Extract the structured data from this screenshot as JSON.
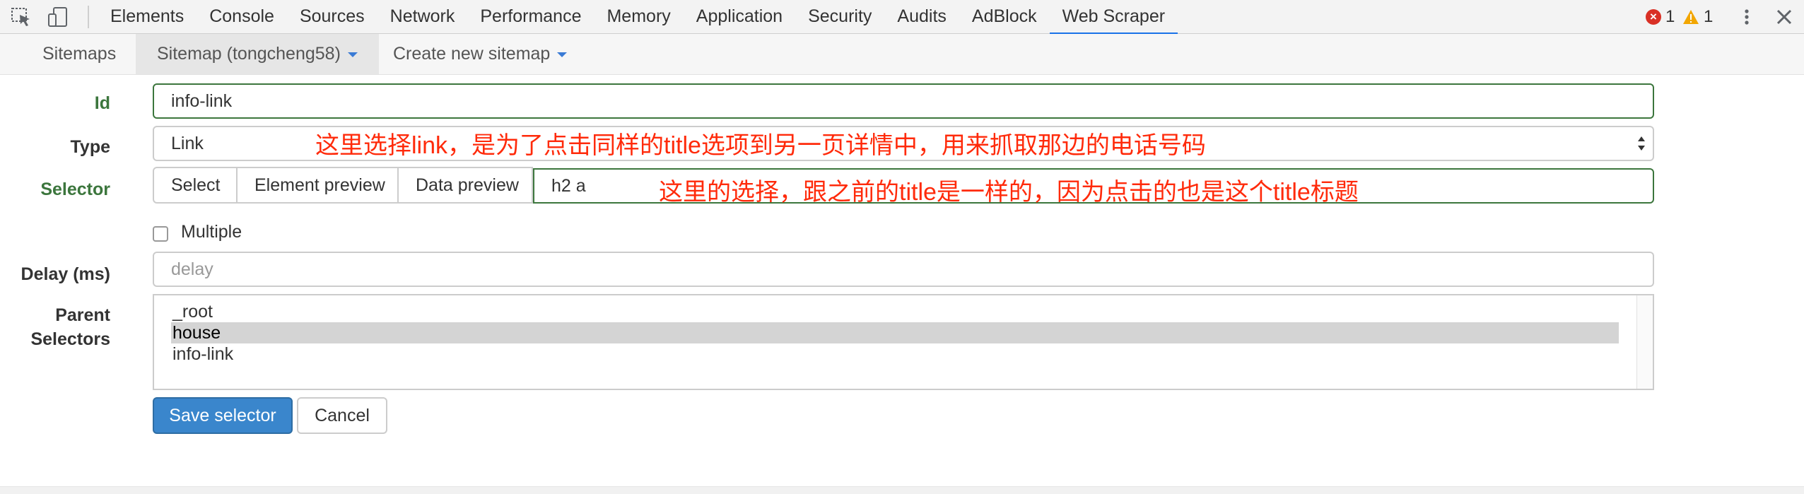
{
  "devtools": {
    "tabs": [
      "Elements",
      "Console",
      "Sources",
      "Network",
      "Performance",
      "Memory",
      "Application",
      "Security",
      "Audits",
      "AdBlock",
      "Web Scraper"
    ],
    "active_tab": "Web Scraper",
    "error_count": "1",
    "warning_count": "1",
    "icons": [
      "inspect-element-icon",
      "device-toolbar-icon",
      "error-icon",
      "warning-icon",
      "more-options-icon",
      "close-icon"
    ]
  },
  "nav": {
    "sitemaps": "Sitemaps",
    "current_sitemap": "Sitemap (tongcheng58)",
    "create_new": "Create new sitemap"
  },
  "form": {
    "id_label": "Id",
    "id_value": "info-link",
    "type_label": "Type",
    "type_value": "Link",
    "selector_label": "Selector",
    "select_button": "Select",
    "element_preview_button": "Element preview",
    "data_preview_button": "Data preview",
    "selector_value": "h2 a",
    "multiple_label": "Multiple",
    "multiple_checked": false,
    "delay_label": "Delay (ms)",
    "delay_placeholder": "delay",
    "parent_label_line1": "Parent",
    "parent_label_line2": "Selectors",
    "parent_options": [
      "_root",
      "house",
      "info-link"
    ],
    "parent_selected": "house",
    "save_button": "Save selector",
    "cancel_button": "Cancel"
  },
  "annotations": {
    "type_note": "这里选择link，是为了点击同样的title选项到另一页详情中，用来抓取那边的电话号码",
    "selector_note": "这里的选择，跟之前的title是一样的，因为点击的也是这个title标题"
  },
  "colors": {
    "success_green": "#3c763d",
    "primary_blue": "#3a86cc",
    "annotation_red": "#ff2a0a",
    "active_tab_underline": "#1a73e8"
  }
}
